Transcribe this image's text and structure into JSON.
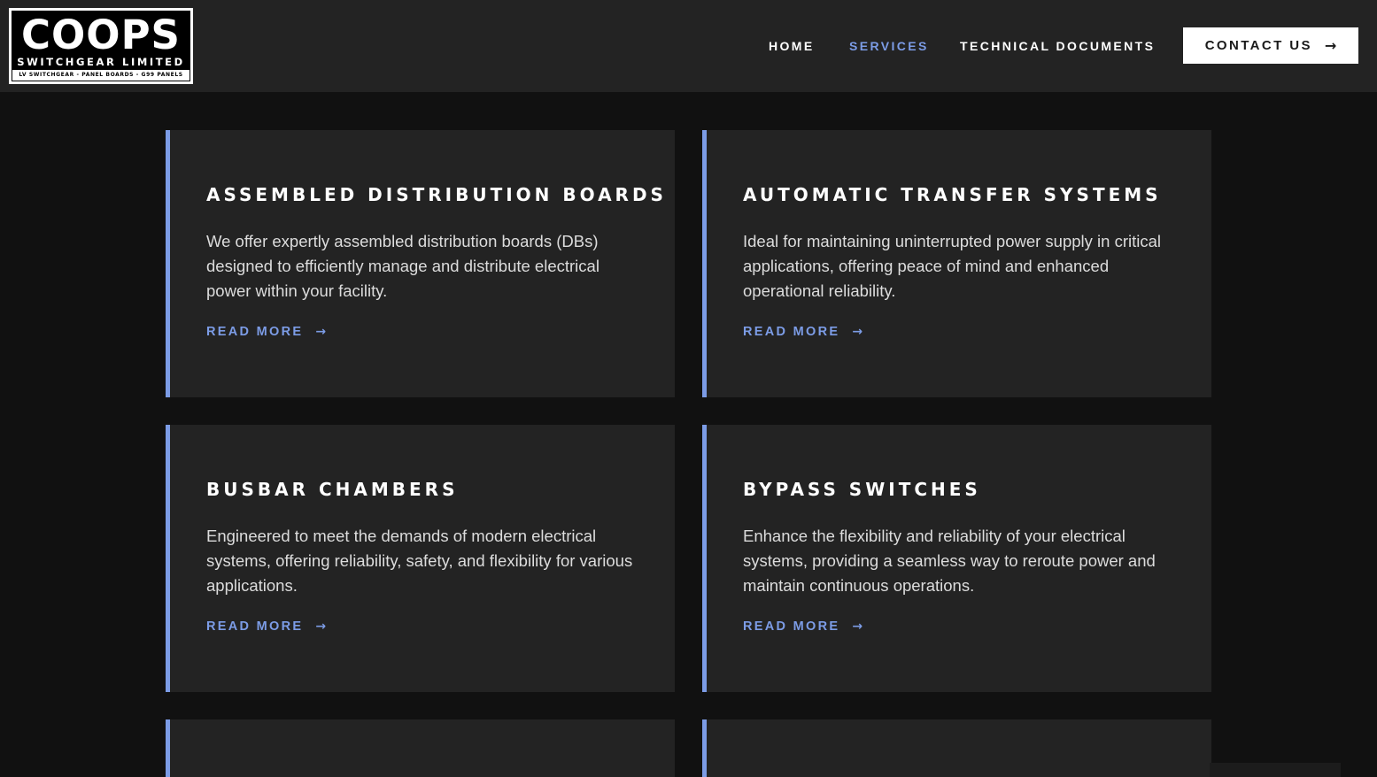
{
  "logo": {
    "name": "COOPS",
    "subtitle": "SWITCHGEAR LIMITED",
    "tagline": "LV SWITCHGEAR - PANEL BOARDS - G99 PANELS"
  },
  "nav": {
    "items": [
      {
        "label": "HOME",
        "active": false
      },
      {
        "label": "SERVICES",
        "active": true
      },
      {
        "label": "TECHNICAL DOCUMENTS",
        "active": false
      }
    ],
    "contact_label": "CONTACT US",
    "arrow": "→"
  },
  "colors": {
    "accent": "#7c9ce6",
    "header_bg": "#232323",
    "page_bg": "#111111",
    "card_bg": "#232323"
  },
  "services": [
    {
      "title": "ASSEMBLED DISTRIBUTION BOARDS",
      "description": "We offer expertly assembled distribution boards (DBs) designed to efficiently manage and distribute electrical power within your facility.",
      "link": "READ MORE"
    },
    {
      "title": "AUTOMATIC TRANSFER SYSTEMS",
      "description": "Ideal for maintaining uninterrupted power supply in critical applications, offering peace of mind and enhanced operational reliability.",
      "link": "READ MORE"
    },
    {
      "title": "BUSBAR CHAMBERS",
      "description": "Engineered to meet the demands of modern electrical systems, offering reliability, safety, and flexibility for various applications.",
      "link": "READ MORE"
    },
    {
      "title": "BYPASS SWITCHES",
      "description": "Enhance the flexibility and reliability of your electrical systems, providing a seamless way to reroute power and maintain continuous operations.",
      "link": "READ MORE"
    }
  ]
}
